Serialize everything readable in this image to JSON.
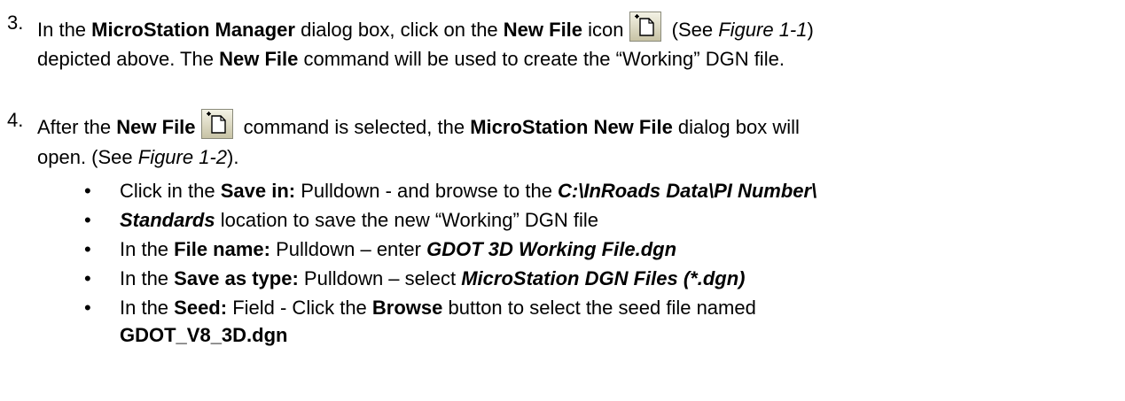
{
  "steps": [
    {
      "number": "3.",
      "line1": {
        "t1": "In the ",
        "b1": "MicroStation Manager",
        "t2": " dialog box, click on the ",
        "b2": "New File",
        "t3": " icon",
        "t4": " (See ",
        "fig": "Figure 1-1",
        "t5": ")"
      },
      "line2": {
        "t1": "depicted above. The ",
        "b1": "New File",
        "t2": " command will be used to create the “Working” DGN file."
      }
    },
    {
      "number": "4.",
      "line1": {
        "t1": "After the ",
        "b1": "New File",
        "t2": " command is selected, the ",
        "b2": "MicroStation New File",
        "t3": " dialog box will"
      },
      "line2": {
        "t1": "open. (See ",
        "fig": "Figure 1-2",
        "t2": ")."
      }
    }
  ],
  "bullets": [
    {
      "t1": "Click in the ",
      "b1": "Save in:",
      "t2": " Pulldown - and browse to the ",
      "bi1": "C:\\InRoads Data\\PI Number\\"
    },
    {
      "bi1": "Standards",
      "t1": " location to save the new “Working” DGN file"
    },
    {
      "t1": "In the ",
      "b1": "File name:",
      "t2": " Pulldown – enter ",
      "bi1": "GDOT 3D Working File.dgn"
    },
    {
      "t1": "In the ",
      "b1": "Save as type:",
      "t2": " Pulldown – select ",
      "bi1": "MicroStation DGN Files (*.dgn)"
    },
    {
      "t1": "In the ",
      "b1": "Seed:",
      "t2": " Field  - Click the ",
      "b2": "Browse",
      "t3": " button to select the seed file named",
      "b3": "GDOT_V8_3D.dgn"
    }
  ],
  "bullet_glyph": "•",
  "icon": {
    "name": "new-file-icon",
    "bg_top": "#f4f3e6",
    "bg_bottom": "#c7c2a4",
    "border": "#8a8a7a"
  }
}
